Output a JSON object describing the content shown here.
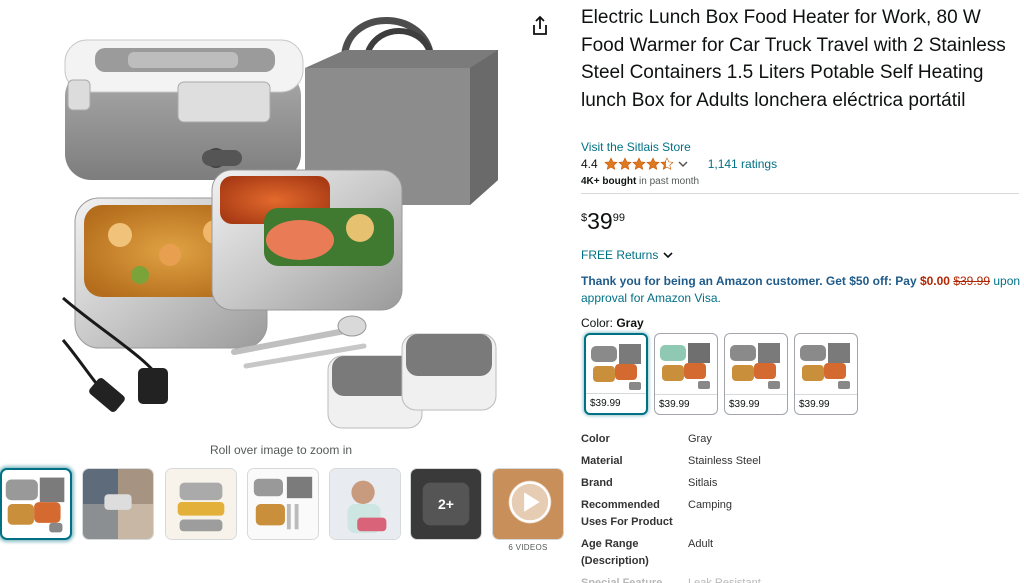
{
  "product": {
    "title": "Electric Lunch Box Food Heater for Work, 80 W Food Warmer for Car Truck Travel with 2 Stainless Steel Containers 1.5 Liters Potable Self Heating lunch Box for Adults lonchera eléctrica portátil",
    "store_link": "Visit the Sitlais Store",
    "rating_value": "4.4",
    "rating_stars_filled": 4.4,
    "ratings_count": "1,141 ratings",
    "bought_bold": "4K+ bought",
    "bought_rest": " in past month",
    "price_symbol": "$",
    "price_whole": "39",
    "price_fraction": "99",
    "returns_label": "FREE Returns",
    "promo_bold": "Thank you for being an Amazon customer. Get $50 off: Pay ",
    "promo_zero": "$0.00",
    "promo_strike": "$39.99",
    "promo_rest": " upon approval for Amazon Visa.",
    "color_label": "Color: ",
    "color_selected": "Gray"
  },
  "gallery": {
    "zoom_hint": "Roll over image to zoom in",
    "more_count": "2+",
    "videos_label": "6 VIDEOS"
  },
  "swatches": [
    {
      "price": "$39.99",
      "lid_color": "#8a8a8a",
      "bag_color": "#7a7a7a"
    },
    {
      "price": "$39.99",
      "lid_color": "#8fc9b4",
      "bag_color": "#6f6f6f"
    },
    {
      "price": "$39.99",
      "lid_color": "#8a8a8a",
      "bag_color": "#7a7a7a"
    },
    {
      "price": "$39.99",
      "lid_color": "#8a8a8a",
      "bag_color": "#7a7a7a"
    }
  ],
  "specs": [
    {
      "key": "Color",
      "value": "Gray"
    },
    {
      "key": "Material",
      "value": "Stainless Steel"
    },
    {
      "key": "Brand",
      "value": "Sitlais"
    },
    {
      "key": "Recommended Uses For Product",
      "value": "Camping"
    },
    {
      "key": "Age Range (Description)",
      "value": "Adult"
    },
    {
      "key": "Special Feature",
      "value": "Leak Resistant"
    }
  ],
  "colors": {
    "link": "#007185",
    "star": "#de7921",
    "price_red": "#b12704",
    "selected_border": "#007185"
  }
}
